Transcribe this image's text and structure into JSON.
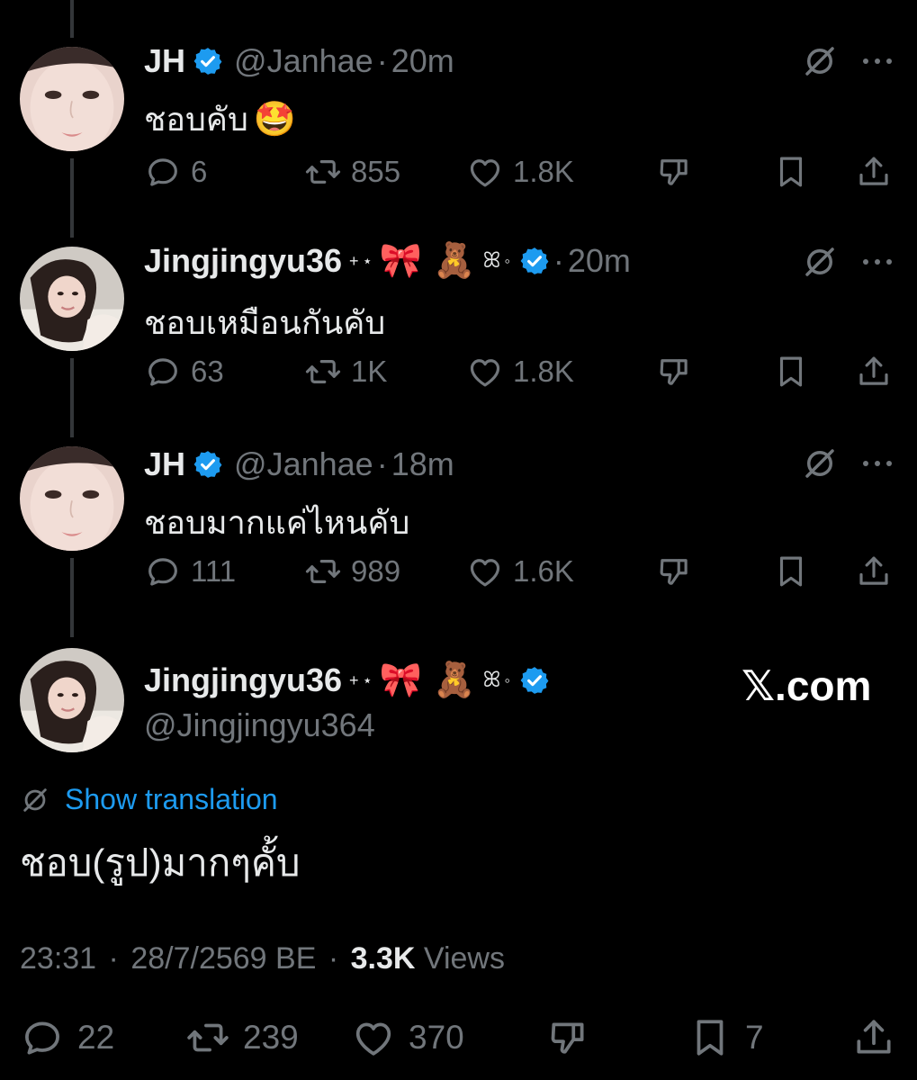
{
  "brand_colors": {
    "accent": "#1d9bf0",
    "text": "#e7e9ea",
    "muted": "#71767b",
    "background": "#000000"
  },
  "replies": [
    {
      "name": "JH",
      "handle": "@Janhae",
      "time": "20m",
      "text": "ชอบคับ",
      "text_emoji": "🤩",
      "replies": "6",
      "reposts": "855",
      "likes": "1.8K"
    },
    {
      "name": "Jingjingyu36",
      "name_deco": {
        "plus": "+",
        "star": "⋆",
        "bow": "🎀",
        "bear": "🧸",
        "swirl": "ꕤ",
        "circle": "◦"
      },
      "time": "20m",
      "text": "ชอบเหมือนกันคับ",
      "replies": "63",
      "reposts": "1K",
      "likes": "1.8K"
    },
    {
      "name": "JH",
      "handle": "@Janhae",
      "time": "18m",
      "text": "ชอบมากแค่ไหนคับ",
      "replies": "111",
      "reposts": "989",
      "likes": "1.6K"
    }
  ],
  "main_post": {
    "name": "Jingjingyu36",
    "name_deco": {
      "plus": "+",
      "star": "⋆",
      "bow": "🎀",
      "bear": "🧸",
      "swirl": "ꕤ",
      "circle": "◦"
    },
    "handle": "@Jingjingyu364",
    "show_translation": "Show translation",
    "text": "ชอบ(รูป)มากๆคั้บ",
    "time": "23:31",
    "date": "28/7/2569 BE",
    "views_count": "3.3K",
    "views_label": "Views",
    "replies": "22",
    "reposts": "239",
    "likes": "370",
    "bookmarks": "7"
  },
  "watermark": "𝕏.com",
  "separator": "·",
  "icons": [
    "reply-icon",
    "repost-icon",
    "like-icon",
    "dislike-icon",
    "bookmark-icon",
    "share-icon",
    "grok-icon",
    "more-icon",
    "verified-badge-icon",
    "translate-icon"
  ]
}
